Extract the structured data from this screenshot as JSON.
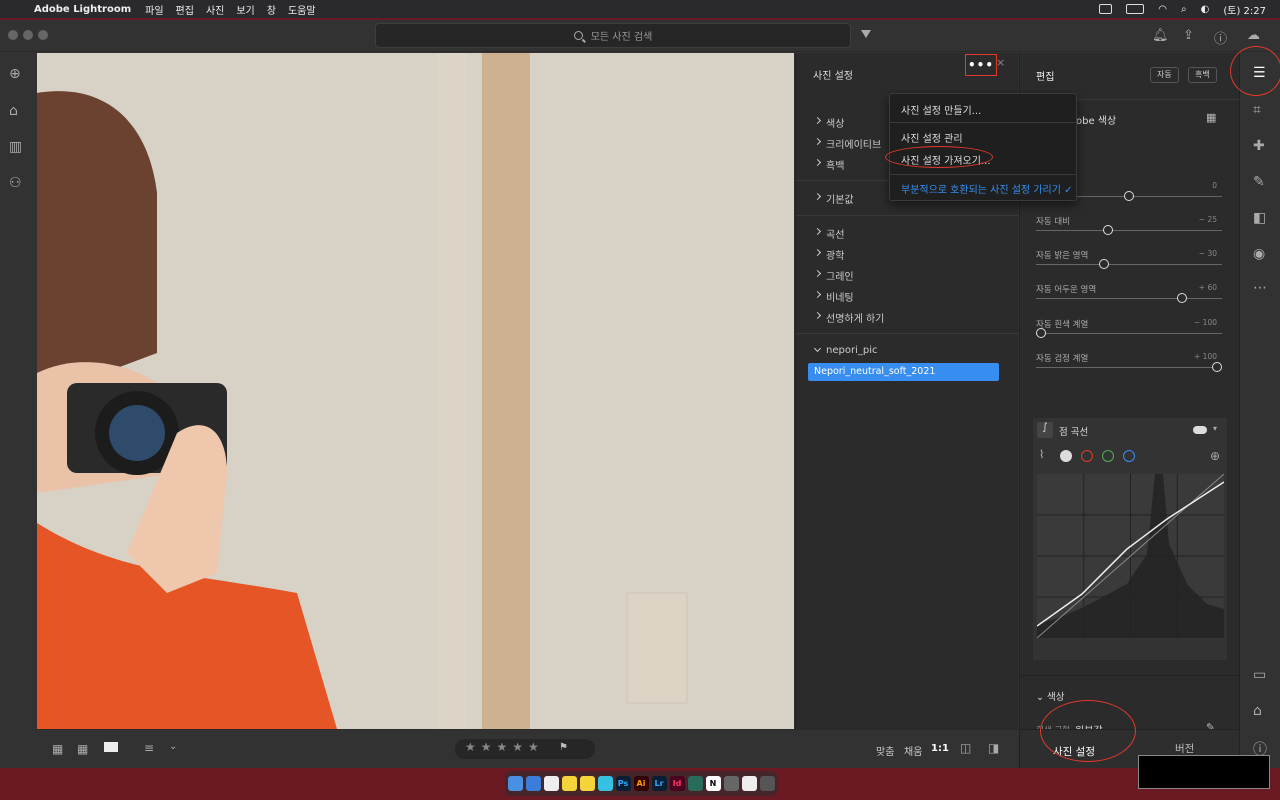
{
  "menubar": {
    "apple_icon": "apple-icon",
    "app_name": "Adobe Lightroom",
    "menus": [
      "파일",
      "편집",
      "사진",
      "보기",
      "창",
      "도움말"
    ],
    "clock": "(토) 2:27"
  },
  "toolbar": {
    "search_placeholder": "모든 사진 검색"
  },
  "preset_panel": {
    "title": "사진 설정",
    "more_label": "•••",
    "close_label": "×",
    "groups1": [
      "색상",
      "크리에이티브",
      "흑백"
    ],
    "groups2": [
      "기본값"
    ],
    "groups3": [
      "곡선",
      "광학",
      "그레인",
      "비네팅",
      "선명하게 하기"
    ],
    "user_group": "nepori_pic",
    "selected_preset": "Nepori_neutral_soft_2021"
  },
  "dropdown_menu": {
    "items": [
      "사진 설정 만들기...",
      "사진 설정 관리",
      "사진 설정 가져오기...",
      "부분적으로 호환되는 사진 설정 가리기"
    ],
    "check": "✓"
  },
  "edit_panel": {
    "title": "편집",
    "auto_label": "자동",
    "bw_label": "흑백",
    "profile_label": "obe 색상",
    "sliders": [
      {
        "label": "",
        "value": "0",
        "pos": 0.5
      },
      {
        "label": "자동 대비",
        "value": "− 25",
        "pos": 0.38
      },
      {
        "label": "자동 밝은 영역",
        "value": "− 30",
        "pos": 0.36
      },
      {
        "label": "자동 어두운 영역",
        "value": "+ 60",
        "pos": 0.8
      },
      {
        "label": "자동 흰색 계열",
        "value": "− 100",
        "pos": 0.0
      },
      {
        "label": "자동 검정 계열",
        "value": "+ 100",
        "pos": 1.0
      }
    ],
    "curve_title": "점 곡선",
    "color_section": "색상",
    "wb_label": "흰색 균형",
    "wb_value": "원본값"
  },
  "bottom_bar": {
    "stars": "★★★★★",
    "fit_label": "맞춤",
    "fill_label": "채움",
    "ratio_label": "1:1",
    "tab_presets": "사진 설정",
    "tab_versions": "버전"
  },
  "colors": {
    "accent": "#378ef0",
    "annotation_red": "#e03a2a"
  }
}
